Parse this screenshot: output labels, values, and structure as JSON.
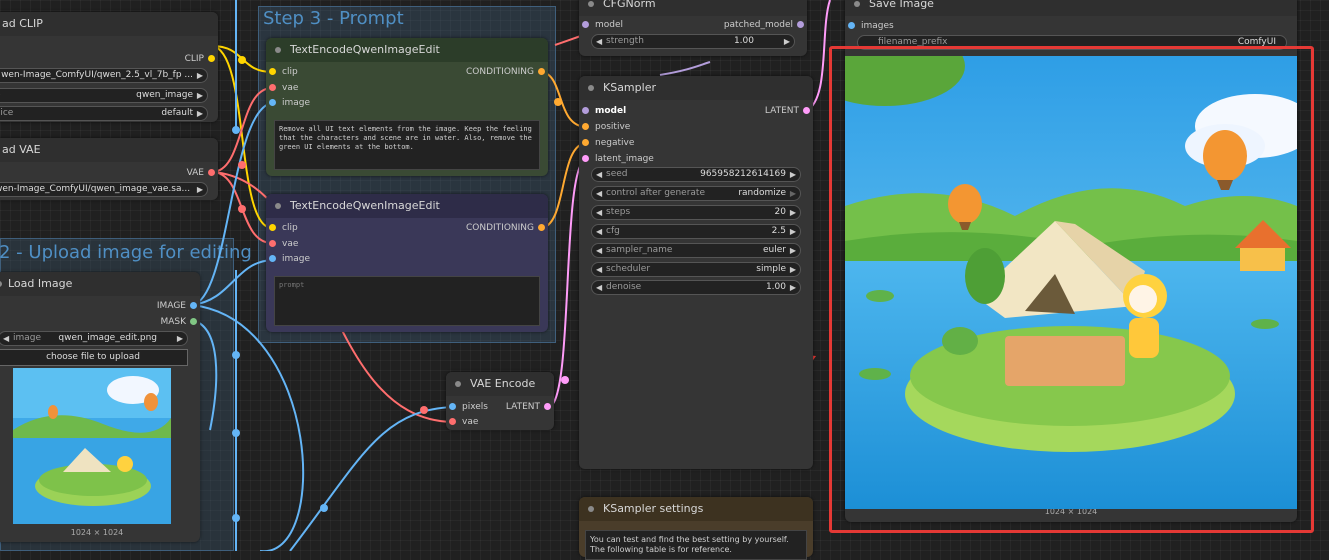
{
  "groups": {
    "step3": {
      "title": "Step 3 - Prompt",
      "color": "#3f5f7c"
    },
    "step2": {
      "title": "2 - Upload image for editing",
      "color": "#3f5f7c"
    }
  },
  "colors": {
    "clip": "#ffd500",
    "vae": "#ff6e6e",
    "image": "#64b5f6",
    "conditioning": "#ffa931",
    "latent": "#ff9cf9",
    "model": "#b39ddb",
    "highlight": "#e53935"
  },
  "nodes": {
    "load_clip": {
      "title": "ad CLIP",
      "out_clip": "CLIP",
      "w_name": {
        "label": "",
        "value": "wen-Image_ComfyUI/qwen_2.5_vl_7b_fp ..."
      },
      "w_type": {
        "label": "e",
        "value": "qwen_image"
      },
      "w_device": {
        "label": "vice",
        "value": "default"
      }
    },
    "load_vae": {
      "title": "ad VAE",
      "out_vae": "VAE",
      "w_name": {
        "value": "wen-Image_ComfyUI/qwen_image_vae.sa..."
      }
    },
    "load_image": {
      "title": "Load Image",
      "out_image": "IMAGE",
      "out_mask": "MASK",
      "w_image": {
        "label": "image",
        "value": "qwen_image_edit.png"
      },
      "upload_button": "choose file to upload",
      "caption": "1024 × 1024"
    },
    "text_encode_1": {
      "title": "TextEncodeQwenImageEdit",
      "in_clip": "clip",
      "in_vae": "vae",
      "in_image": "image",
      "out": "CONDITIONING",
      "prompt": "Remove all UI text elements from the image. Keep the feeling that the characters and scene are in water. Also, remove the green UI elements at the bottom."
    },
    "text_encode_2": {
      "title": "TextEncodeQwenImageEdit",
      "in_clip": "clip",
      "in_vae": "vae",
      "in_image": "image",
      "out": "CONDITIONING",
      "placeholder": "prompt"
    },
    "cfgnorm": {
      "title": "CFGNorm",
      "in_model": "model",
      "out_model": "patched_model",
      "w_strength": {
        "label": "strength",
        "value": "1.00"
      }
    },
    "ksampler": {
      "title": "KSampler",
      "in_model": "model",
      "in_positive": "positive",
      "in_negative": "negative",
      "in_latent": "latent_image",
      "out": "LATENT",
      "widgets": [
        {
          "label": "seed",
          "value": "965958212614169"
        },
        {
          "label": "control after generate",
          "value": "randomize"
        },
        {
          "label": "steps",
          "value": "20"
        },
        {
          "label": "cfg",
          "value": "2.5"
        },
        {
          "label": "sampler_name",
          "value": "euler"
        },
        {
          "label": "scheduler",
          "value": "simple"
        },
        {
          "label": "denoise",
          "value": "1.00"
        }
      ]
    },
    "vae_encode": {
      "title": "VAE Encode",
      "in_pixels": "pixels",
      "in_vae": "vae",
      "out": "LATENT"
    },
    "save_image": {
      "title": "Save Image",
      "in_images": "images",
      "w_prefix": {
        "label": "filename_prefix",
        "value": "ComfyUI"
      },
      "caption": "1024 × 1024"
    },
    "ksampler_settings": {
      "title": "KSampler settings",
      "text": "You can test and find the best setting by yourself. The following table is for reference."
    }
  }
}
